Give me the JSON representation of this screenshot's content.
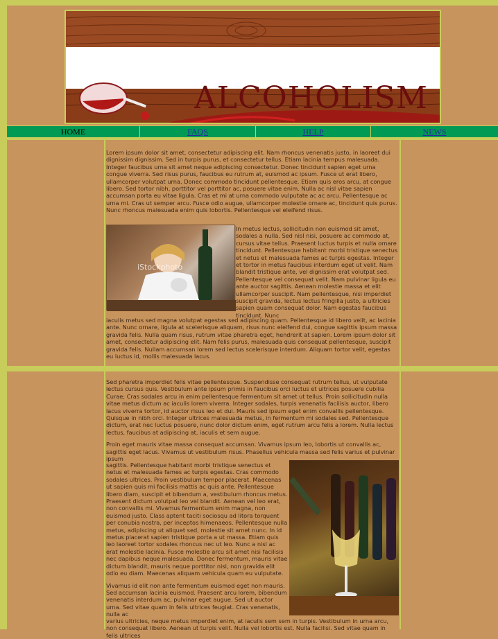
{
  "header": {
    "title": "ALCOHOLISM"
  },
  "nav": {
    "items": [
      {
        "label": "HOME"
      },
      {
        "label": "FAQS"
      },
      {
        "label": "HELP"
      },
      {
        "label": "NEWS"
      }
    ]
  },
  "section1": {
    "paragraph1": "Lorem ipsum dolor sit amet, consectetur adipiscing elit. Nam rhoncus venenatis justo, in laoreet dui dignissim dignissim. Sed in turpis purus, et consectetur tellus. Etiam lacinia tempus malesuada. Integer faucibus urna sit amet neque adipiscing consectetur. Donec tincidunt sapien eget urna congue viverra. Sed risus purus, faucibus eu rutrum at, euismod ac ipsum. Fusce ut erat libero, ullamcorper volutpat urna. Donec commodo tincidunt pellentesque. Etiam quis eros arcu, at congue libero. Sed tortor nibh, porttitor vel porttitor ac, posuere vitae enim. Nulla ac nisl vitae sapien accumsan porta eu vitae ligula. Cras et mi at urna commodo vulputate ac ac arcu. Pellentesque ac urna mi. Cras ut semper arcu. Fusce odio augue, ullamcorper molestie ornare ac, tincidunt quis purus. Nunc rhoncus malesuada enim quis lobortis. Pellentesque vel eleifend risus.",
    "paragraph2_wrap": "In metus lectus, sollicitudin non euismod sit amet, sodales a nulla. Sed nisl nisi, posuere ac commodo at, cursus vitae tellus. Praesent luctus turpis et nulla ornare tincidunt. Pellentesque habitant morbi tristique senectus et netus et malesuada fames ac turpis egestas. Integer et tortor in metus faucibus interdum eget ut velit. Nam blandit tristique ante, vel dignissim erat volutpat sed. Pellentesque vel consequat velit. Nam pulvinar ligula eu ante auctor sagittis. Aenean molestie massa et elit ullamcorper suscipit. Nam pellentesque, nisi imperdiet suscipit gravida, lectus lectus fringilla justo, a ultricies sapien quam consequat dolor. Nam egestas faucibus tincidunt. Nunc",
    "paragraph2_rest": "iaculis metus sed magna volutpat egestas sed adipiscing quam. Pellentesque id libero velit, ac lacinia ante. Nunc ornare, ligula at scelerisque aliquam, risus nunc eleifend dui, congue sagittis ipsum massa gravida felis. Nulla quam risus, rutrum vitae pharetra eget, hendrerit at sapien. Lorem ipsum dolor sit amet, consectetur adipiscing elit. Nam felis purus, malesuada quis consequat pellentesque, suscipit gravida felis. Nullam accumsan lorem sed lectus scelerisque interdum. Aliquam tortor velit, egestas eu luctus id, mollis malesuada lacus.",
    "image_watermark": "iStockphoto"
  },
  "section2": {
    "paragraph1": "Sed pharetra imperdiet felis vitae pellentesque. Suspendisse consequat rutrum tellus, ut vulputate lectus cursus quis. Vestibulum ante ipsum primis in faucibus orci luctus et ultrices posuere cubilia Curae; Cras sodales arcu in enim pellentesque fermentum sit amet ut tellus. Proin sollicitudin nulla vitae metus dictum ac iaculis lorem viverra. Integer sodales, turpis venenatis facilisis auctor, libero lacus viverra tortor, id auctor risus leo et dui. Mauris sed ipsum eget enim convallis pellentesque. Quisque in nibh orci. Integer ultrices malesuada metus, in fermentum mi sodales sed. Pellentesque dictum, erat nec luctus posuere, nunc dolor dictum enim, eget rutrum arcu felis a lorem. Nulla lectus lectus, faucibus at adipiscing at, iaculis et sem augue.",
    "paragraph2_top": "Proin eget mauris vitae massa consequat accumsan. Vivamus ipsum leo, lobortis ut convallis ac, sagittis eget lacus. Vivamus ut vestibulum risus. Phasellus vehicula massa sed felis varius et pulvinar ipsum",
    "paragraph2_wrap": "sagittis. Pellentesque habitant morbi tristique senectus et netus et malesuada fames ac turpis egestas. Cras commodo sodales ultrices. Proin vestibulum tempor placerat. Maecenas ut sapien quis mi facilisis mattis ac quis ante. Pellentesque libero diam, suscipit et bibendum a, vestibulum rhoncus metus. Praesent dictum volutpat leo vel blandit. Aenean vel leo erat, non convallis mi. Vivamus fermentum enim magna, non euismod justo. Class aptent taciti sociosqu ad litora torquent per conubia nostra, per inceptos himenaeos. Pellentesque nulla metus, adipiscing ut aliquet sed, molestie sit amet nunc. In id metus placerat sapien tristique porta a ut massa. Etiam quis leo laoreet tortor sodales rhoncus nec ut leo. Nunc a nisl ac erat molestie lacinia. Fusce molestie arcu sit amet nisi facilisis nec dapibus neque malesuada. Donec fermentum, mauris vitae dictum blandit, mauris neque porttitor nisl, non gravida elit odio eu diam. Maecenas aliquam vehicula quam eu vulputate.",
    "paragraph3_wrap": "Vivamus id elit non ante fermentum euismod eget non mauris. Sed accumsan lacinia euismod. Praesent arcu lorem, bibendum venenatis interdum ac, pulvinar eget augue. Sed ut auctor urna. Sed vitae quam in felis ultrices feugiat. Cras venenatis, nulla ac",
    "paragraph3_rest": "varius ultricies, neque metus imperdiet enim, at iaculis sem sem in turpis. Vestibulum in urna arcu, non consequat libero. Aenean ut turpis velit. Nulla vel lobortis est. Nulla facilisi. Sed vitae quam in felis ultrices"
  },
  "colors": {
    "background": "#c8945e",
    "accent_lime": "#c8cc5a",
    "nav_green": "#009a55",
    "text": "#3a2614",
    "link": "#2b2b9c"
  }
}
